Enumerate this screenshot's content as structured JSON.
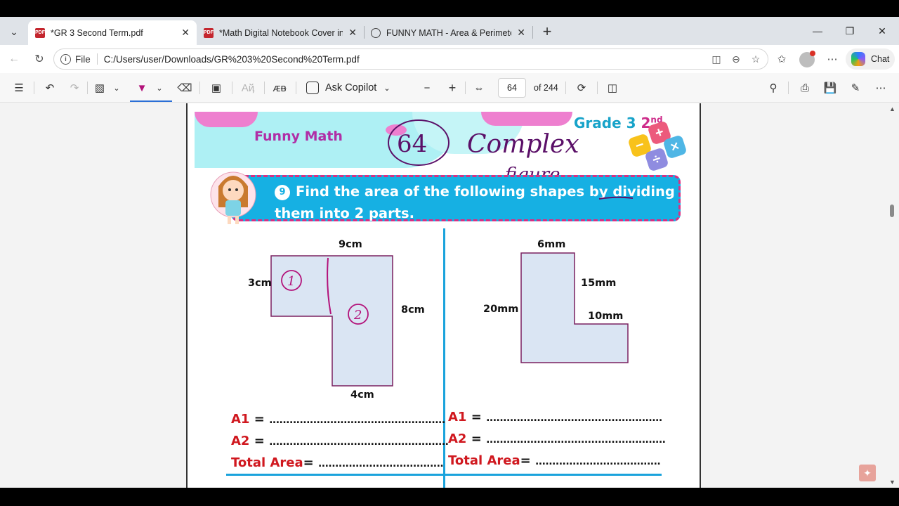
{
  "tabs": [
    {
      "label": "*GR 3 Second Term.pdf",
      "icon": "pdf-icon",
      "active": true
    },
    {
      "label": "*Math Digital Notebook Cover in C",
      "icon": "pdf-icon",
      "active": false
    },
    {
      "label": "FUNNY MATH - Area & Perimeter",
      "icon": "globe-icon",
      "active": false
    }
  ],
  "address": {
    "scheme_label": "File",
    "url": "C:/Users/user/Downloads/GR%203%20Second%20Term.pdf"
  },
  "chat_label": "Chat",
  "pdf_toolbar": {
    "ask_copilot": "Ask Copilot",
    "page_current": "64",
    "page_total": "of 244"
  },
  "page": {
    "header_title": "Funny Math",
    "grade_text": "Grade 3 ",
    "grade_num": "2",
    "grade_sup": "nd",
    "handwriting_number": "64",
    "handwriting_line1": "Complex",
    "handwriting_line2": "figure",
    "question_number": "9",
    "question_text": "Find the area of the following shapes by dividing them into 2 parts.",
    "left_shape": {
      "top": "9cm",
      "left": "3cm",
      "right": "8cm",
      "bottom": "4cm",
      "mark1": "1",
      "mark2": "2"
    },
    "right_shape": {
      "top": "6mm",
      "left": "20mm",
      "inner_right": "15mm",
      "step": "10mm"
    },
    "answers_left": [
      {
        "label": "A1",
        "eq": " = ",
        "dots": "...................................................."
      },
      {
        "label": "A2",
        "eq": " = ",
        "dots": "....................................................."
      },
      {
        "label": "Total Area",
        "eq": "= ",
        "dots": "....................................."
      }
    ],
    "answers_right": [
      {
        "label": "A1",
        "eq": " = ",
        "dots": "...................................................."
      },
      {
        "label": "A2",
        "eq": " = ",
        "dots": "....................................................."
      },
      {
        "label": "Total Area",
        "eq": "= ",
        "dots": "....................................."
      }
    ]
  }
}
